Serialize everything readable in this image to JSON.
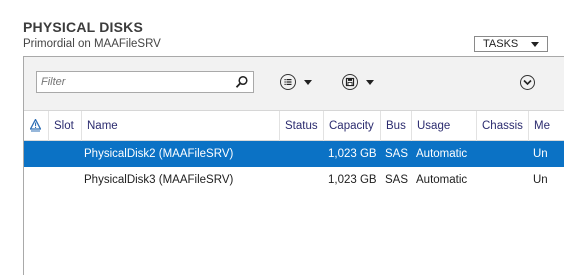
{
  "section": {
    "title": "PHYSICAL DISKS",
    "subtitle": "Primordial on MAAFileSRV",
    "tasks_label": "TASKS"
  },
  "toolbar": {
    "filter_placeholder": "Filter",
    "icons": [
      "search-icon",
      "list-view-icon",
      "save-query-icon",
      "expand-icon"
    ]
  },
  "table": {
    "columns": [
      "",
      "Slot",
      "Name",
      "Status",
      "Capacity",
      "Bus",
      "Usage",
      "Chassis",
      "Me"
    ],
    "rows": [
      {
        "slot": "",
        "name": "PhysicalDisk2 (MAAFileSRV)",
        "status": "",
        "capacity": "1,023 GB",
        "bus": "SAS",
        "usage": "Automatic",
        "chassis": "",
        "media": "Un",
        "selected": true
      },
      {
        "slot": "",
        "name": "PhysicalDisk3 (MAAFileSRV)",
        "status": "",
        "capacity": "1,023 GB",
        "bus": "SAS",
        "usage": "Automatic",
        "chassis": "",
        "media": "Un",
        "selected": false
      }
    ]
  },
  "colors": {
    "selected_row": "#0b72c5",
    "header_text": "#2b2b6f",
    "warning_icon": "#2f6fb5"
  }
}
